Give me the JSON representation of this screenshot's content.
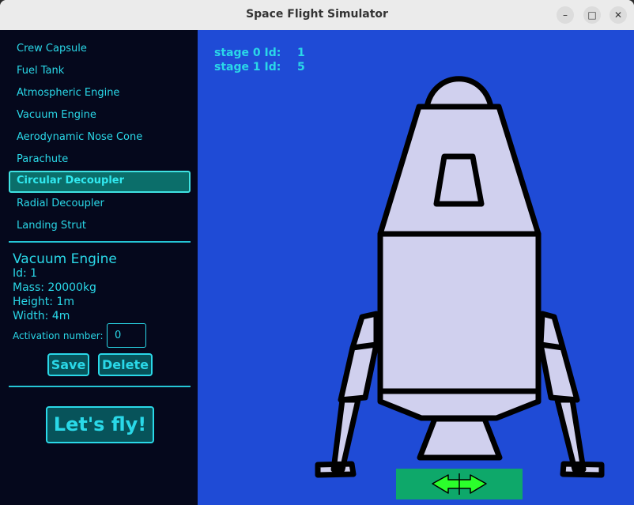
{
  "window": {
    "title": "Space Flight Simulator"
  },
  "parts": [
    "Crew Capsule",
    "Fuel Tank",
    "Atmospheric Engine",
    "Vacuum Engine",
    "Aerodynamic Nose Cone",
    "Parachute",
    "Circular Decoupler",
    "Radial Decoupler",
    "Landing Strut"
  ],
  "selected_part_index": 6,
  "selected": {
    "name": "Vacuum Engine",
    "id": "Id: 1",
    "mass": "Mass: 20000kg",
    "height": "Height: 1m",
    "width": "Width: 4m",
    "activation_label": "Activation number:",
    "activation_value": "0"
  },
  "buttons": {
    "save": "Save",
    "delete": "Delete",
    "fly": "Let's fly!"
  },
  "stages": [
    {
      "label": "stage 0 Id:",
      "value": "1"
    },
    {
      "label": "stage 1 Id:",
      "value": "5"
    }
  ],
  "colors": {
    "sidebar_bg": "#05081c",
    "accent": "#2ad8e8",
    "canvas_bg": "#1f4bd6",
    "rocket_fill": "#d0d0ee",
    "move_handle": "#0ea86a",
    "arrow": "#2bff2b"
  },
  "icons": {
    "minimize": "minimize-icon",
    "maximize": "maximize-icon",
    "close": "close-icon",
    "move": "move-arrows-icon"
  }
}
